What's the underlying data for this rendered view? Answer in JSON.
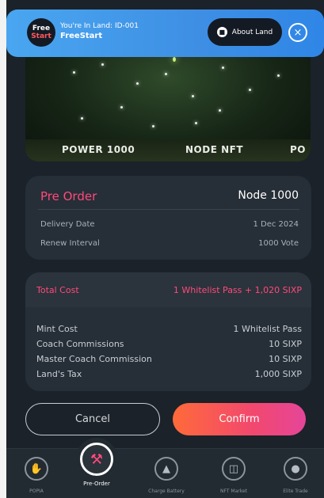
{
  "banner": {
    "logo_line1": "Free",
    "logo_line2": "Start",
    "land_line": "You're In Land: ID-001",
    "land_name": "FreeStart",
    "about_label": "About Land"
  },
  "hero": {
    "strip_items": [
      "POWER 1000",
      "NODE NFT",
      "PO"
    ]
  },
  "order": {
    "title": "Pre Order",
    "node": "Node 1000",
    "rows": [
      {
        "label": "Delivery Date",
        "value": "1 Dec 2024"
      },
      {
        "label": "Renew Interval",
        "value": "1000 Vote"
      }
    ]
  },
  "cost": {
    "total_label": "Total Cost",
    "total_value": "1 Whitelist Pass + 1,020 SIXP",
    "rows": [
      {
        "label": "Mint Cost",
        "value": "1 Whitelist Pass"
      },
      {
        "label": "Coach Commissions",
        "value": "10 SIXP"
      },
      {
        "label": "Master Coach Commission",
        "value": "10 SIXP"
      },
      {
        "label": "Land's Tax",
        "value": "1,000 SIXP"
      }
    ]
  },
  "actions": {
    "cancel": "Cancel",
    "confirm": "Confirm"
  },
  "nav": {
    "items": [
      {
        "label": "POPIA",
        "icon": "hand-coin-icon"
      },
      {
        "label": "Pre-Order",
        "icon": "hammer-icon"
      },
      {
        "label": "Charge Battery",
        "icon": "flame-icon"
      },
      {
        "label": "NFT Market",
        "icon": "cart-icon"
      },
      {
        "label": "Elite Trade",
        "icon": "coins-icon"
      }
    ]
  },
  "colors": {
    "accent": "#ff4a7a",
    "banner": "#3e8fe4",
    "background": "#1b2229"
  }
}
